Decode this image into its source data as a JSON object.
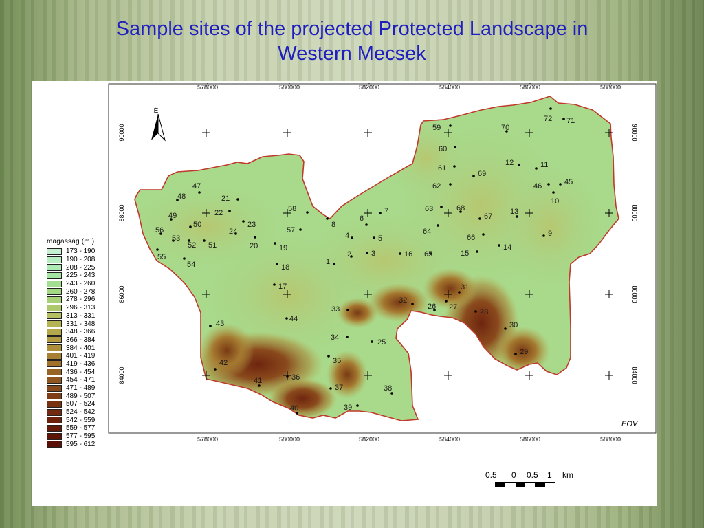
{
  "title_line1": "Sample sites of the projected Protected Landscape in",
  "title_line2": "Western Mecsek",
  "map": {
    "x_ticks": [
      "578000",
      "580000",
      "582000",
      "584000",
      "586000",
      "588000"
    ],
    "y_ticks": [
      "90000",
      "88000",
      "86000",
      "84000"
    ],
    "north_label": "É",
    "projection_label": "EOV",
    "sites": [
      {
        "id": "1",
        "x": 486,
        "y": 384
      },
      {
        "id": "2",
        "x": 511,
        "y": 373
      },
      {
        "id": "3",
        "x": 534,
        "y": 368
      },
      {
        "id": "4",
        "x": 512,
        "y": 346
      },
      {
        "id": "5",
        "x": 544,
        "y": 346
      },
      {
        "id": "6",
        "x": 533,
        "y": 327
      },
      {
        "id": "7",
        "x": 553,
        "y": 310
      },
      {
        "id": "8",
        "x": 476,
        "y": 318
      },
      {
        "id": "9",
        "x": 791,
        "y": 343
      },
      {
        "id": "10",
        "x": 805,
        "y": 280
      },
      {
        "id": "11",
        "x": 780,
        "y": 245
      },
      {
        "id": "12",
        "x": 755,
        "y": 240
      },
      {
        "id": "13",
        "x": 752,
        "y": 315
      },
      {
        "id": "14",
        "x": 726,
        "y": 357
      },
      {
        "id": "15",
        "x": 694,
        "y": 366
      },
      {
        "id": "16",
        "x": 582,
        "y": 369
      },
      {
        "id": "17",
        "x": 399,
        "y": 414
      },
      {
        "id": "18",
        "x": 403,
        "y": 384
      },
      {
        "id": "19",
        "x": 400,
        "y": 354
      },
      {
        "id": "20",
        "x": 371,
        "y": 345
      },
      {
        "id": "21",
        "x": 346,
        "y": 290
      },
      {
        "id": "22",
        "x": 334,
        "y": 307
      },
      {
        "id": "23",
        "x": 354,
        "y": 322
      },
      {
        "id": "24",
        "x": 343,
        "y": 340
      },
      {
        "id": "25",
        "x": 541,
        "y": 497
      },
      {
        "id": "26",
        "x": 632,
        "y": 451
      },
      {
        "id": "27",
        "x": 649,
        "y": 438
      },
      {
        "id": "28",
        "x": 692,
        "y": 453
      },
      {
        "id": "29",
        "x": 750,
        "y": 515
      },
      {
        "id": "30",
        "x": 735,
        "y": 478
      },
      {
        "id": "31",
        "x": 668,
        "y": 425
      },
      {
        "id": "32",
        "x": 600,
        "y": 442
      },
      {
        "id": "33",
        "x": 506,
        "y": 451
      },
      {
        "id": "34",
        "x": 505,
        "y": 490
      },
      {
        "id": "35",
        "x": 478,
        "y": 518
      },
      {
        "id": "36",
        "x": 418,
        "y": 548
      },
      {
        "id": "37",
        "x": 481,
        "y": 565
      },
      {
        "id": "38",
        "x": 570,
        "y": 572
      },
      {
        "id": "39",
        "x": 520,
        "y": 590
      },
      {
        "id": "40",
        "x": 432,
        "y": 601
      },
      {
        "id": "41",
        "x": 377,
        "y": 561
      },
      {
        "id": "42",
        "x": 313,
        "y": 537
      },
      {
        "id": "43",
        "x": 306,
        "y": 474
      },
      {
        "id": "44",
        "x": 417,
        "y": 463
      },
      {
        "id": "45",
        "x": 815,
        "y": 268
      },
      {
        "id": "46",
        "x": 798,
        "y": 268
      },
      {
        "id": "47",
        "x": 290,
        "y": 280
      },
      {
        "id": "48",
        "x": 258,
        "y": 291
      },
      {
        "id": "49",
        "x": 249,
        "y": 319
      },
      {
        "id": "50",
        "x": 277,
        "y": 330
      },
      {
        "id": "51",
        "x": 297,
        "y": 350
      },
      {
        "id": "52",
        "x": 275,
        "y": 350
      },
      {
        "id": "53",
        "x": 252,
        "y": 350
      },
      {
        "id": "54",
        "x": 268,
        "y": 376
      },
      {
        "id": "55",
        "x": 229,
        "y": 363
      },
      {
        "id": "56",
        "x": 234,
        "y": 340
      },
      {
        "id": "57",
        "x": 437,
        "y": 334
      },
      {
        "id": "58",
        "x": 447,
        "y": 309
      },
      {
        "id": "59",
        "x": 655,
        "y": 183
      },
      {
        "id": "60",
        "x": 662,
        "y": 214
      },
      {
        "id": "61",
        "x": 661,
        "y": 242
      },
      {
        "id": "62",
        "x": 655,
        "y": 268
      },
      {
        "id": "63",
        "x": 642,
        "y": 301
      },
      {
        "id": "64",
        "x": 637,
        "y": 328
      },
      {
        "id": "65",
        "x": 627,
        "y": 369
      },
      {
        "id": "66",
        "x": 703,
        "y": 341
      },
      {
        "id": "67",
        "x": 698,
        "y": 318
      },
      {
        "id": "68",
        "x": 670,
        "y": 308
      },
      {
        "id": "69",
        "x": 689,
        "y": 256
      },
      {
        "id": "70",
        "x": 737,
        "y": 191
      },
      {
        "id": "71",
        "x": 820,
        "y": 173
      },
      {
        "id": "72",
        "x": 801,
        "y": 158
      }
    ],
    "label_offsets_note": ""
  },
  "legend": {
    "title": "magasság (m )",
    "entries": [
      {
        "label": "173 - 190",
        "color": "#c6f0cf"
      },
      {
        "label": "190 - 208",
        "color": "#b8eec2"
      },
      {
        "label": "208 - 225",
        "color": "#aeeab3"
      },
      {
        "label": "225 - 243",
        "color": "#a6e6a3"
      },
      {
        "label": "243 - 260",
        "color": "#a2df92"
      },
      {
        "label": "260 - 278",
        "color": "#a3d883"
      },
      {
        "label": "278 - 296",
        "color": "#a7d077"
      },
      {
        "label": "296 - 313",
        "color": "#aec86c"
      },
      {
        "label": "313 - 331",
        "color": "#b3bf60"
      },
      {
        "label": "331 - 348",
        "color": "#b5b455"
      },
      {
        "label": "348 - 366",
        "color": "#b4a84c"
      },
      {
        "label": "366 - 384",
        "color": "#b19b43"
      },
      {
        "label": "384 - 401",
        "color": "#ad8e3b"
      },
      {
        "label": "401 - 419",
        "color": "#a78033"
      },
      {
        "label": "419 - 436",
        "color": "#a0722c"
      },
      {
        "label": "436 - 454",
        "color": "#986426"
      },
      {
        "label": "454 - 471",
        "color": "#8f5620"
      },
      {
        "label": "471 - 489",
        "color": "#87491b"
      },
      {
        "label": "489 - 507",
        "color": "#7f3d16"
      },
      {
        "label": "507 - 524",
        "color": "#783212"
      },
      {
        "label": "524 - 542",
        "color": "#72290f"
      },
      {
        "label": "542 - 559",
        "color": "#6c210c"
      },
      {
        "label": "559 - 577",
        "color": "#661a0a"
      },
      {
        "label": "577 - 595",
        "color": "#5f1408"
      },
      {
        "label": "595 - 612",
        "color": "#590f07"
      }
    ]
  },
  "scale": {
    "labels": [
      "0.5",
      "0",
      "0.5",
      "1",
      "km"
    ]
  },
  "colors": {
    "title": "#1f1fbf",
    "boundary": "#c0392b"
  }
}
